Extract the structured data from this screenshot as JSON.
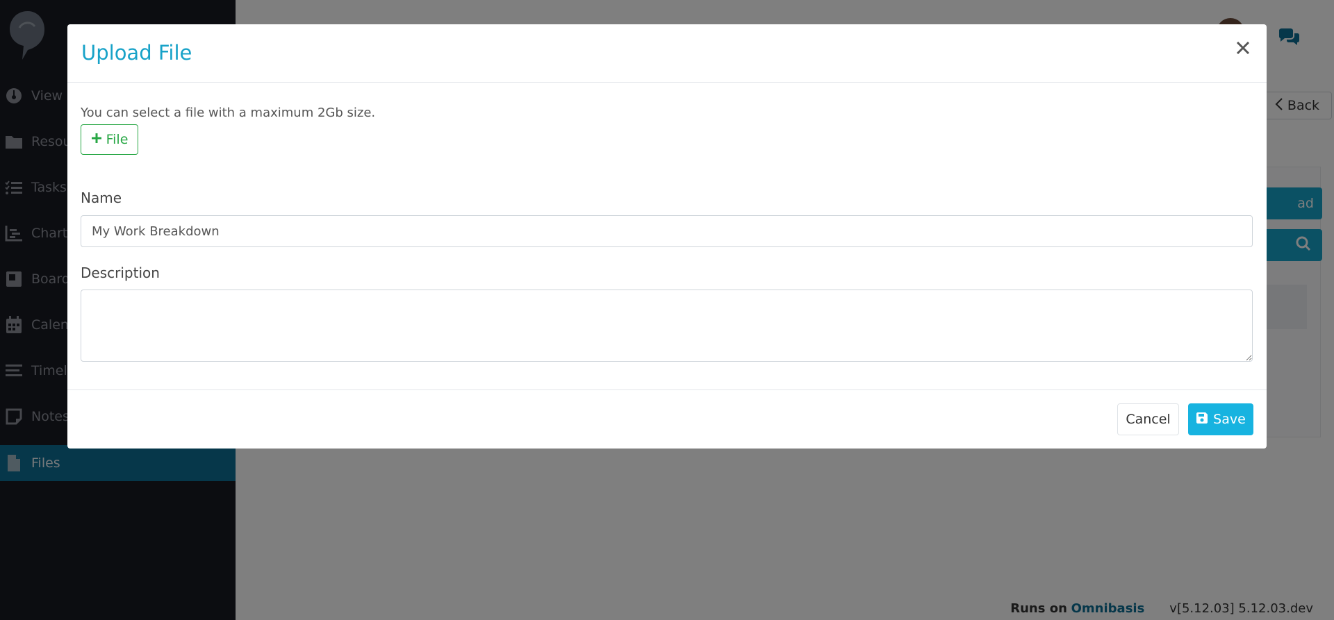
{
  "sidebar": {
    "items": [
      {
        "label": "View",
        "icon": "dashboard-icon"
      },
      {
        "label": "Resou",
        "icon": "folder-icon"
      },
      {
        "label": "Tasks",
        "icon": "tasks-list-icon"
      },
      {
        "label": "Chart",
        "icon": "chart-icon"
      },
      {
        "label": "Board",
        "icon": "board-icon"
      },
      {
        "label": "Calen",
        "icon": "calendar-icon"
      },
      {
        "label": "Timeli",
        "icon": "timeline-icon"
      },
      {
        "label": "Notes",
        "icon": "note-icon"
      },
      {
        "label": "Files",
        "icon": "file-icon",
        "active": true
      }
    ]
  },
  "header": {
    "back_label": "Back"
  },
  "background": {
    "upload_label": "ad"
  },
  "footer": {
    "runs_on": "Runs on",
    "brand": "Omnibasis",
    "version": "v[5.12.03] 5.12.03.dev"
  },
  "modal": {
    "title": "Upload File",
    "hint": "You can select a file with a maximum 2Gb size.",
    "file_button": "File",
    "name_label": "Name",
    "name_value": "My Work Breakdown",
    "description_label": "Description",
    "description_value": "",
    "cancel_label": "Cancel",
    "save_label": "Save"
  },
  "colors": {
    "accent": "#17a2c8",
    "save": "#17b3e0",
    "success": "#28a745",
    "sidebar_bg": "#181a22",
    "sidebar_active": "#0d6f95"
  }
}
